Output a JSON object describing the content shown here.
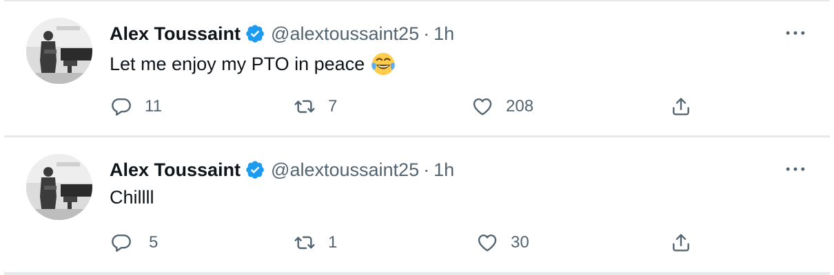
{
  "tweets": [
    {
      "name": "Alex Toussaint",
      "handle": "@alextoussaint25",
      "separator": "·",
      "time": "1h",
      "text": "Let me enjoy my PTO in peace",
      "emoji": "face-with-tears-of-joy",
      "replies": "11",
      "retweets": "7",
      "likes": "208"
    },
    {
      "name": "Alex Toussaint",
      "handle": "@alextoussaint25",
      "separator": "·",
      "time": "1h",
      "text": "Chillll",
      "replies": "5",
      "retweets": "1",
      "likes": "30"
    }
  ],
  "colors": {
    "verified": "#1d9bf0",
    "secondary_text": "#536471",
    "primary_text": "#0f1419",
    "border": "#e6e9ec"
  },
  "icons": [
    "verified-badge-icon",
    "more-icon",
    "reply-icon",
    "retweet-icon",
    "like-icon",
    "share-icon"
  ]
}
